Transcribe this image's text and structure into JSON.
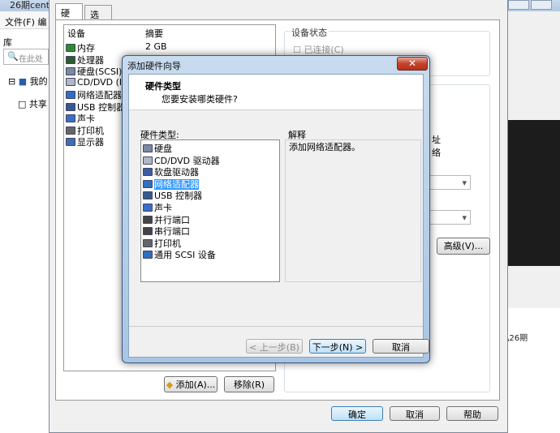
{
  "bg": {
    "title": "26期cent",
    "menu_file": "文件(F) 编",
    "library_label": "库",
    "search_placeholder": "在此处",
    "tree_item1": "我的",
    "tree_item2": "共享",
    "vm_label": "\\26期"
  },
  "settings": {
    "tab_hardware": "硬件",
    "tab_options": "选项",
    "col_device": "设备",
    "col_summary": "摘要",
    "devices": [
      {
        "name": "内存",
        "summary": "2 GB",
        "icon": "memory-icon",
        "color": "#2e8b2e"
      },
      {
        "name": "处理器",
        "summary": "",
        "icon": "cpu-icon",
        "color": "#2c5d2c"
      },
      {
        "name": "硬盘(SCSI)",
        "summary": "",
        "icon": "harddisk-icon",
        "color": "#7a8aa0"
      },
      {
        "name": "CD/DVD (IDE)",
        "summary": "",
        "icon": "cdrom-icon",
        "color": "#b0b8c8"
      },
      {
        "name": "网络适配器",
        "summary": "",
        "icon": "network-icon",
        "color": "#2f6ec0"
      },
      {
        "name": "USB 控制器",
        "summary": "",
        "icon": "usb-icon",
        "color": "#355a8e"
      },
      {
        "name": "声卡",
        "summary": "",
        "icon": "sound-icon",
        "color": "#3a6fc8"
      },
      {
        "name": "打印机",
        "summary": "",
        "icon": "printer-icon",
        "color": "#666"
      },
      {
        "name": "显示器",
        "summary": "",
        "icon": "display-icon",
        "color": "#3f6fb0"
      }
    ],
    "device_status_legend": "设备状态",
    "connected_label": "已连接(C)",
    "add_button": "添加(A)...",
    "remove_button": "移除(R)",
    "advanced_button": "高级(V)...",
    "ok_button": "确定",
    "cancel_button": "取消",
    "help_button": "帮助",
    "partial_text1": "址",
    "partial_text2": "络"
  },
  "wizard": {
    "title": "添加硬件向导",
    "close": "✕",
    "heading": "硬件类型",
    "subheading": "您要安装哪类硬件?",
    "types_label": "硬件类型:",
    "desc_label": "解释",
    "description": "添加网络适配器。",
    "types": [
      {
        "name": "硬盘",
        "icon": "harddisk-icon",
        "color": "#7a8aa0"
      },
      {
        "name": "CD/DVD 驱动器",
        "icon": "cdrom-icon",
        "color": "#b0b8c8"
      },
      {
        "name": "软盘驱动器",
        "icon": "floppy-icon",
        "color": "#3a5fa0"
      },
      {
        "name": "网络适配器",
        "icon": "network-icon",
        "color": "#2f6ec0",
        "selected": true
      },
      {
        "name": "USB 控制器",
        "icon": "usb-icon",
        "color": "#355a8e"
      },
      {
        "name": "声卡",
        "icon": "sound-icon",
        "color": "#3a6fc8"
      },
      {
        "name": "并行端口",
        "icon": "parallel-port-icon",
        "color": "#444"
      },
      {
        "name": "串行端口",
        "icon": "serial-port-icon",
        "color": "#444"
      },
      {
        "name": "打印机",
        "icon": "printer-icon",
        "color": "#666"
      },
      {
        "name": "通用 SCSI 设备",
        "icon": "scsi-icon",
        "color": "#2f6ec0"
      }
    ],
    "prev_button": "< 上一步(B)",
    "next_button": "下一步(N) >",
    "cancel_button": "取消"
  }
}
